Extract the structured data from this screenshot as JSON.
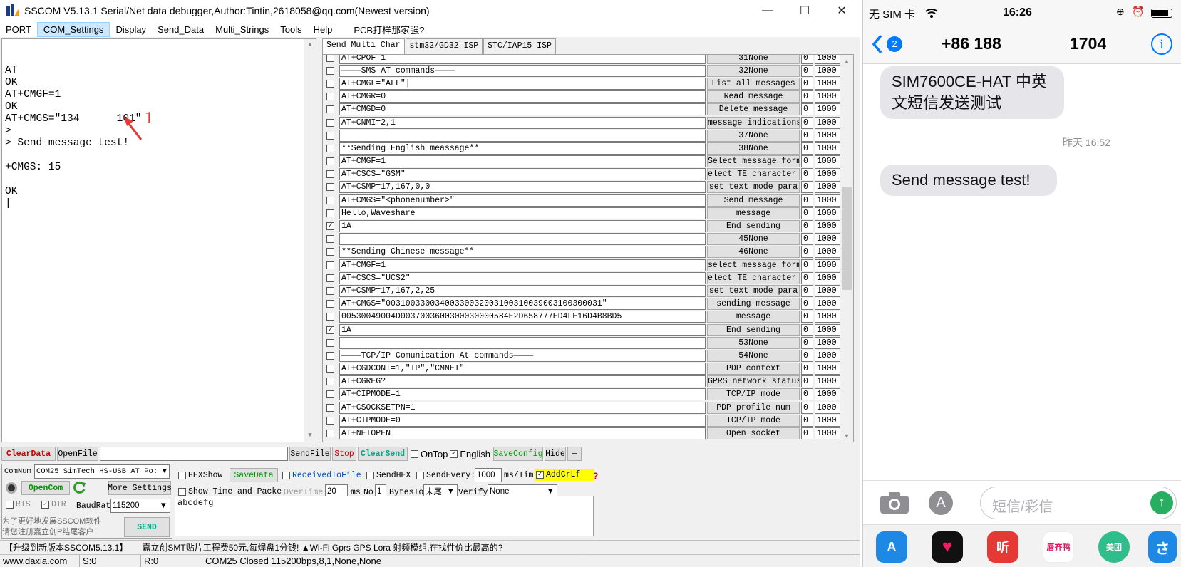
{
  "window": {
    "title": "SSCOM V5.13.1 Serial/Net data debugger,Author:Tintin,2618058@qq.com(Newest version)",
    "controls": {
      "minimize": "—",
      "maximize": "☐",
      "close": "✕"
    }
  },
  "menu": {
    "items": [
      "PORT",
      "COM_Settings",
      "Display",
      "Send_Data",
      "Multi_Strings",
      "Tools",
      "Help",
      "PCB打样那家强?"
    ],
    "active": "COM_Settings"
  },
  "terminal": {
    "text": "AT\nOK\nAT+CMGF=1\nOK\nAT+CMGS=\"134      101\"\n>\n> Send message test!\n\n+CMGS: 15\n\nOK\n|",
    "annotation_number": "1"
  },
  "multichar": {
    "tabs": [
      "Send Multi Char",
      "stm32/GD32 ISP",
      "STC/IAP15 ISP"
    ],
    "active_tab": "Send Multi Char",
    "rows": [
      {
        "checked": false,
        "cmd": "AT+CPOF=1",
        "btn": "31None",
        "n1": "0",
        "n2": "1000"
      },
      {
        "checked": false,
        "cmd": "————SMS AT commands————",
        "btn": "32None",
        "n1": "0",
        "n2": "1000"
      },
      {
        "checked": false,
        "cmd": "AT+CMGL=\"ALL\"|",
        "btn": "List all messages",
        "n1": "0",
        "n2": "1000"
      },
      {
        "checked": false,
        "cmd": "AT+CMGR=0",
        "btn": "Read message",
        "n1": "0",
        "n2": "1000"
      },
      {
        "checked": false,
        "cmd": "AT+CMGD=0",
        "btn": "Delete message",
        "n1": "0",
        "n2": "1000"
      },
      {
        "checked": false,
        "cmd": "AT+CNMI=2,1",
        "btn": "message indications",
        "n1": "0",
        "n2": "1000"
      },
      {
        "checked": false,
        "cmd": "",
        "btn": "37None",
        "n1": "0",
        "n2": "1000"
      },
      {
        "checked": false,
        "cmd": "**Sending English meassage**",
        "btn": "38None",
        "n1": "0",
        "n2": "1000"
      },
      {
        "checked": false,
        "cmd": "AT+CMGF=1",
        "btn": "Select message forma",
        "n1": "0",
        "n2": "1000"
      },
      {
        "checked": false,
        "cmd": "AT+CSCS=\"GSM\"",
        "btn": "elect TE character s",
        "n1": "0",
        "n2": "1000"
      },
      {
        "checked": false,
        "cmd": "AT+CSMP=17,167,0,0",
        "btn": "set text mode para",
        "n1": "0",
        "n2": "1000"
      },
      {
        "checked": false,
        "cmd": "AT+CMGS=\"<phonenumber>\"",
        "btn": "Send message",
        "n1": "0",
        "n2": "1000"
      },
      {
        "checked": false,
        "cmd": "Hello,Waveshare",
        "btn": "message",
        "n1": "0",
        "n2": "1000"
      },
      {
        "checked": true,
        "cmd": "1A",
        "btn": "End sending",
        "n1": "0",
        "n2": "1000"
      },
      {
        "checked": false,
        "cmd": "",
        "btn": "45None",
        "n1": "0",
        "n2": "1000"
      },
      {
        "checked": false,
        "cmd": "**Sending Chinese message**",
        "btn": "46None",
        "n1": "0",
        "n2": "1000"
      },
      {
        "checked": false,
        "cmd": "AT+CMGF=1",
        "btn": "select message forma",
        "n1": "0",
        "n2": "1000"
      },
      {
        "checked": false,
        "cmd": "AT+CSCS=\"UCS2\"",
        "btn": "elect TE character s",
        "n1": "0",
        "n2": "1000"
      },
      {
        "checked": false,
        "cmd": "AT+CSMP=17,167,2,25",
        "btn": "set text mode para",
        "n1": "0",
        "n2": "1000"
      },
      {
        "checked": false,
        "cmd": "AT+CMGS=\"00310033003400330032003100310039003100300031\"",
        "btn": "sending message",
        "n1": "0",
        "n2": "1000"
      },
      {
        "checked": false,
        "cmd": "00530049004D0037003600300030000584E2D658777ED4FE16D4B8BD5",
        "btn": "message",
        "n1": "0",
        "n2": "1000"
      },
      {
        "checked": true,
        "cmd": "1A",
        "btn": "End sending",
        "n1": "0",
        "n2": "1000"
      },
      {
        "checked": false,
        "cmd": "",
        "btn": "53None",
        "n1": "0",
        "n2": "1000"
      },
      {
        "checked": false,
        "cmd": "————TCP/IP Comunication At commands————",
        "btn": "54None",
        "n1": "0",
        "n2": "1000"
      },
      {
        "checked": false,
        "cmd": "AT+CGDCONT=1,\"IP\",\"CMNET\"",
        "btn": "PDP context",
        "n1": "0",
        "n2": "1000"
      },
      {
        "checked": false,
        "cmd": "AT+CGREG?",
        "btn": "GPRS network status",
        "n1": "0",
        "n2": "1000"
      },
      {
        "checked": false,
        "cmd": "AT+CIPMODE=1",
        "btn": "TCP/IP mode",
        "n1": "0",
        "n2": "1000"
      },
      {
        "checked": false,
        "cmd": "AT+CSOCKSETPN=1",
        "btn": "PDP profile num",
        "n1": "0",
        "n2": "1000"
      },
      {
        "checked": false,
        "cmd": "AT+CIPMODE=0",
        "btn": "TCP/IP mode",
        "n1": "0",
        "n2": "1000"
      },
      {
        "checked": false,
        "cmd": "AT+NETOPEN",
        "btn": "Open socket",
        "n1": "0",
        "n2": "1000"
      }
    ]
  },
  "controls": {
    "clear_data": "ClearData",
    "open_file": "OpenFile",
    "send_file": "SendFile",
    "stop": "Stop",
    "clear_send": "ClearSend",
    "on_top": "OnTop",
    "english": "English",
    "save_config": "SaveConfig",
    "hide": "Hide",
    "dash": "—",
    "com_num_label": "ComNum",
    "com_num_value": "COM25 SimTech HS-USB AT Po:",
    "hex_show": "HEXShow",
    "save_data": "SaveData",
    "received_to_file": "ReceivedToFile",
    "send_hex": "SendHEX",
    "send_every": "SendEvery:",
    "send_every_value": "1000",
    "ms_tim": "ms/Tim",
    "add_crlf": "AddCrLf",
    "open_com": "OpenCom",
    "more_settings": "More Settings",
    "show_time": "Show Time and Packe",
    "overtime_label": "OverTime:",
    "overtime_value": "20",
    "ms": "ms",
    "no_label": "No",
    "no_value": "1",
    "bytes_to": "BytesTo",
    "bytes_to_value": "末尾",
    "verify": "Verify",
    "verify_value": "None",
    "rts": "RTS",
    "dtr": "DTR",
    "baud_label": "BaudRate",
    "baud_value": "115200",
    "promo_line1": "为了更好地发展SSCOM软件",
    "promo_line2": "请您注册嘉立创P结尾客户",
    "send": "SEND",
    "send_text": "abcdefg"
  },
  "banner": {
    "left": "【升级到新版本SSCOM5.13.1】",
    "right": "嘉立创SMT贴片工程费50元,每焊盘1分钱! ▲Wi-Fi Gprs GPS Lora 射频模组,在找性价比最高的?"
  },
  "statusbar": {
    "site": "www.daxia.com",
    "s": "S:0",
    "r": "R:0",
    "port": "COM25 Closed  115200bps,8,1,None,None"
  },
  "phone": {
    "carrier": "无 SIM 卡",
    "time": "16:26",
    "back_badge": "2",
    "number_left": "+86 188",
    "number_right": "1704",
    "bubble1": "SIM7600CE-HAT 中英\n文短信发送测试",
    "timestamp": "昨天 16:52",
    "bubble2": "Send message test!",
    "input_placeholder": "短信/彩信",
    "apps": [
      "听",
      "唇齐鸭",
      "美团"
    ]
  },
  "colors": {
    "accent_blue": "#007aff",
    "bubble_gray": "#e5e5ea",
    "send_green": "#27ae60",
    "annotation_red": "#e53935",
    "crlf_yellow": "#ffff00"
  }
}
